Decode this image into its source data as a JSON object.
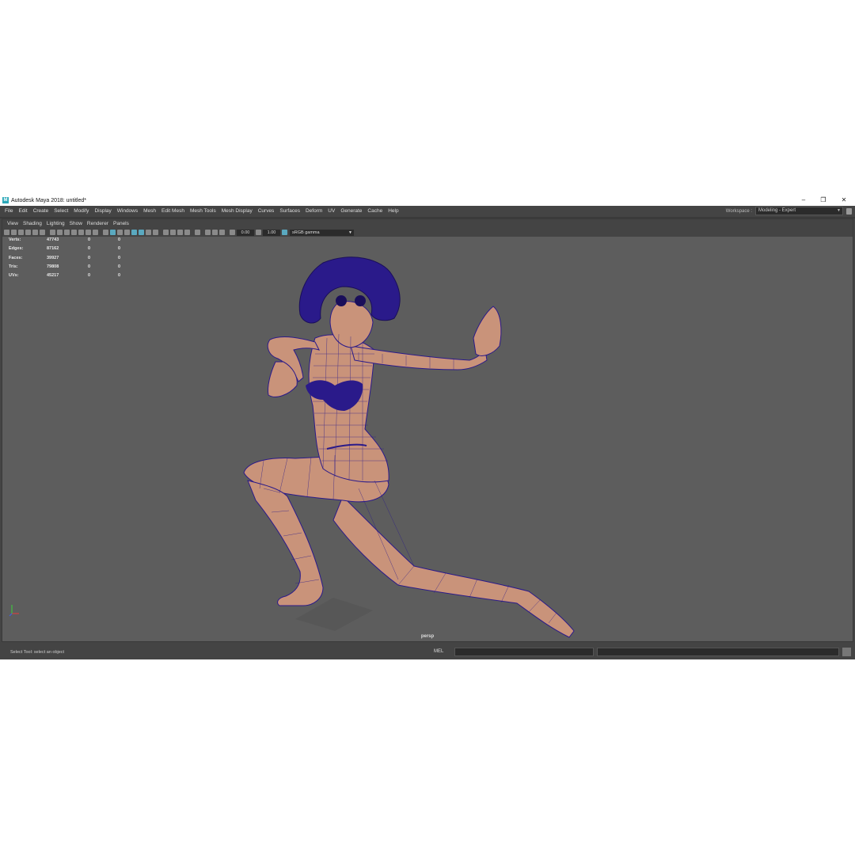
{
  "window": {
    "title": "Autodesk Maya 2018: untitled*"
  },
  "menubar": {
    "items": [
      "File",
      "Edit",
      "Create",
      "Select",
      "Modify",
      "Display",
      "Windows",
      "Mesh",
      "Edit Mesh",
      "Mesh Tools",
      "Mesh Display",
      "Curves",
      "Surfaces",
      "Deform",
      "UV",
      "Generate",
      "Cache",
      "Help"
    ],
    "workspace_label": "Workspace :",
    "workspace_value": "Modeling - Expert"
  },
  "panel_menu": {
    "items": [
      "View",
      "Shading",
      "Lighting",
      "Show",
      "Renderer",
      "Panels"
    ]
  },
  "toolbar": {
    "exposure": "0.00",
    "gamma": "1.00",
    "color_space": "sRGB gamma"
  },
  "hud": {
    "rows": [
      {
        "label": "Verts:",
        "v1": "47743",
        "v2": "0",
        "v3": "0"
      },
      {
        "label": "Edges:",
        "v1": "87162",
        "v2": "0",
        "v3": "0"
      },
      {
        "label": "Faces:",
        "v1": "39927",
        "v2": "0",
        "v3": "0"
      },
      {
        "label": "Tris:",
        "v1": "79808",
        "v2": "0",
        "v3": "0"
      },
      {
        "label": "UVs:",
        "v1": "45217",
        "v2": "0",
        "v3": "0"
      }
    ]
  },
  "viewport": {
    "camera": "persp"
  },
  "statusbar": {
    "help_text": "Select Tool: select an object",
    "mel_label": "MEL"
  },
  "colors": {
    "viewport_bg": "#5d5d5d",
    "wireframe": "#2a1a8a",
    "skin": "#c9937a"
  }
}
